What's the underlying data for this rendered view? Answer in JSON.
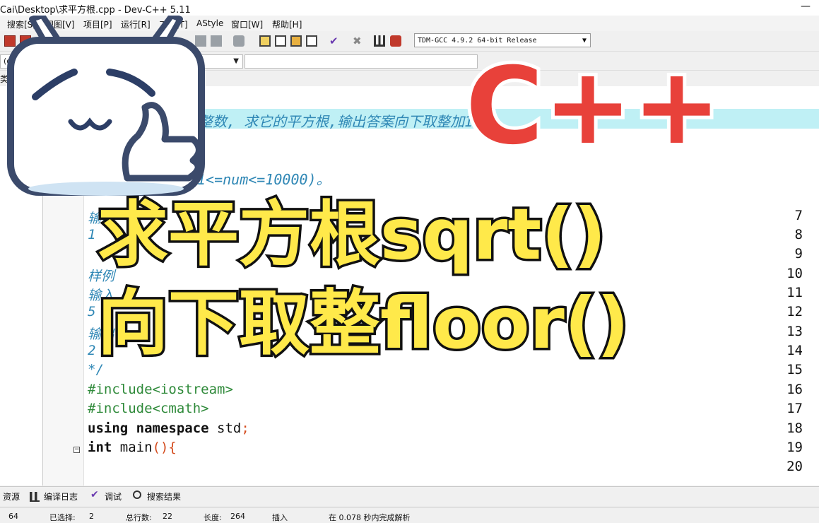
{
  "window": {
    "title": "Cai\\Desktop\\求平方根.cpp - Dev-C++ 5.11",
    "minimize": "—"
  },
  "menu": [
    "搜索[S]",
    "视图[V]",
    "项目[P]",
    "运行[R]",
    "工具[T]",
    "AStyle",
    "窗口[W]",
    "帮助[H]"
  ],
  "toolbar": {
    "compiler": "TDM-GCC 4.9.2 64-bit Release"
  },
  "toolbar2": {
    "scope": "(globals)"
  },
  "tabs": {
    "left_label": "类"
  },
  "editor": {
    "line_numbers": [
      "7",
      "8",
      "9",
      "10",
      "11",
      "12",
      "13",
      "14",
      "15",
      "16",
      "17",
      "18",
      "19",
      "20"
    ],
    "visible_partial_lines": [
      "整数, 求它的平方根,输出答案向下取整加1",
      "1<=num<=10000)。",
      "输出",
      "1",
      "样例",
      "输入",
      "5",
      "输出",
      "2",
      "*/"
    ],
    "code": {
      "include1": "#include<iostream>",
      "include2": "#include<cmath>",
      "using_kw": "using namespace",
      "using_std": " std",
      "semicolon": ";",
      "int_kw": "int",
      "main": " main",
      "paren_brace": "(){"
    }
  },
  "overlay": {
    "cpp_logo": "C++",
    "line1": "求平方根sqrt()",
    "line2": "向下取整floor()"
  },
  "bottom_tabs": [
    "资源",
    "编译日志",
    "调试",
    "搜索结果"
  ],
  "status": {
    "col": "64",
    "selected_label": "已选择:",
    "selected_value": "2",
    "lines_label": "总行数:",
    "lines_value": "22",
    "length_label": "长度:",
    "length_value": "264",
    "mode": "插入",
    "parse_msg": "在 0.078 秒内完成解析"
  },
  "colors": {
    "comment": "#2f87b5",
    "preprocessor": "#2f8a3a",
    "punct": "#d44b1d",
    "overlay_fill": "#ffe94a",
    "cpp_red": "#e8413a"
  }
}
